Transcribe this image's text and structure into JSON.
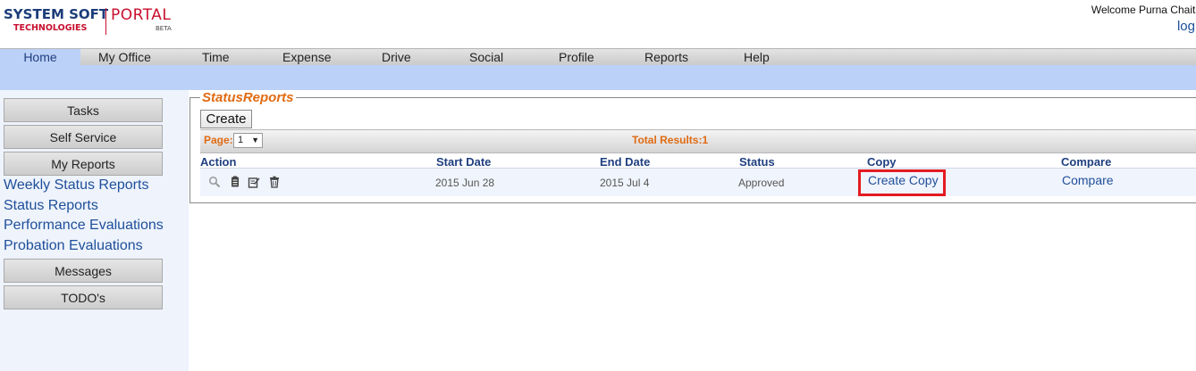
{
  "header": {
    "logo_primary": "SYSTEM SOFT",
    "logo_secondary": "TECHNOLOGIES",
    "logo_portal": "PORTAL",
    "logo_beta": "BETA",
    "welcome_text": "Welcome Purna Chaita",
    "logout_text": "log"
  },
  "nav": {
    "tabs": [
      {
        "label": "Home",
        "active": true
      },
      {
        "label": "My Office"
      },
      {
        "label": "Time"
      },
      {
        "label": "Expense"
      },
      {
        "label": "Drive"
      },
      {
        "label": "Social"
      },
      {
        "label": "Profile"
      },
      {
        "label": "Reports"
      },
      {
        "label": "Help"
      }
    ]
  },
  "sidebar": {
    "tasks": "Tasks",
    "self_service": "Self Service",
    "my_reports": "My Reports",
    "links": [
      "Weekly Status Reports",
      "Status Reports",
      "Performance Evaluations",
      "Probation Evaluations"
    ],
    "messages": "Messages",
    "todos": "TODO's"
  },
  "main": {
    "legend": "StatusReports",
    "create_label": "Create",
    "page_label": "Page:",
    "page_value": "1",
    "total_results": "Total Results:1",
    "columns": [
      "Action",
      "Start Date",
      "End Date",
      "Status",
      "Copy",
      "Compare"
    ],
    "rows": [
      {
        "start_date": "2015 Jun 28",
        "end_date": "2015 Jul 4",
        "status": "Approved",
        "copy": "Create Copy",
        "compare": "Compare"
      }
    ],
    "action_icons": [
      "search-icon",
      "document-icon",
      "edit-icon",
      "trash-icon"
    ]
  },
  "colors": {
    "accent_orange": "#e06b12",
    "link_blue": "#1f4f9a",
    "nav_active": "#bcd1f7",
    "highlight_red": "#e41b23"
  }
}
